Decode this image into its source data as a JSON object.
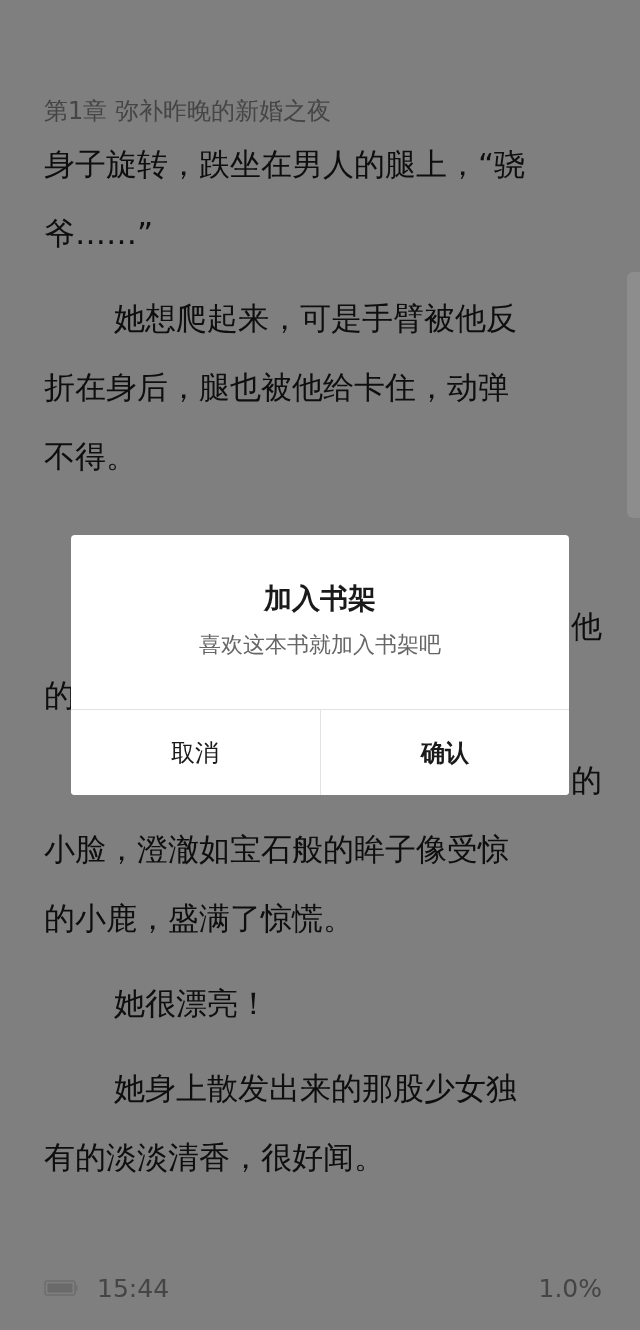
{
  "chapter_title": "第1章 弥补昨晚的新婚之夜",
  "paragraphs": [
    {
      "lines": [
        {
          "text": "身子旋转，跌坐在男人的腿上，“骁"
        },
        {
          "text": "爷……”"
        }
      ]
    },
    {
      "indent": true,
      "lines": [
        {
          "text": "她想爬起来，可是手臂被他反"
        },
        {
          "text": "折在身后，腿也被他给卡住，动弹"
        },
        {
          "text": "不得。"
        }
      ]
    },
    {
      "lines": [
        {
          "text": "他",
          "kind": "tail"
        },
        {
          "text": "的"
        }
      ]
    },
    {
      "lines": [
        {
          "text": "的",
          "kind": "tail"
        },
        {
          "text": "小脸，澄澈如宝石般的眸子像受惊"
        },
        {
          "text": "的小鹿，盛满了惊慌。"
        }
      ]
    },
    {
      "indent": true,
      "lines": [
        {
          "text": "她很漂亮！"
        }
      ]
    },
    {
      "indent": true,
      "lines": [
        {
          "text": "她身上散发出来的那股少女独"
        },
        {
          "text": "有的淡淡清香，很好闻。"
        }
      ]
    }
  ],
  "status": {
    "time": "15:44",
    "progress": "1.0%"
  },
  "dialog": {
    "title": "加入书架",
    "message": "喜欢这本书就加入书架吧",
    "buttons": [
      {
        "kind": "cancel",
        "label": "取消"
      },
      {
        "kind": "confirm",
        "label": "确认"
      }
    ]
  }
}
